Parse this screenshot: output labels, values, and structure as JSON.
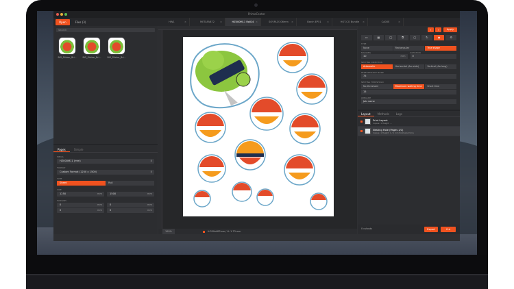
{
  "window": {
    "title": "PrimeCenter"
  },
  "toolbar": {
    "open_label": "Open",
    "files_label": "Files (3)"
  },
  "doc_tabs": [
    {
      "label": "HW1"
    },
    {
      "label": "METAFAB72"
    },
    {
      "label": "HZ000M11 Roll14",
      "active": true
    },
    {
      "label": "SOVRU2106mm"
    },
    {
      "label": "Barch EP51"
    },
    {
      "label": "HOT.CO Bundle"
    },
    {
      "label": "CA00E"
    }
  ],
  "left": {
    "search_placeholder": "Search",
    "thumbnails": [
      {
        "label": "BIG_Sticker_Bri..."
      },
      {
        "label": "BIG_Sticker_Bri..."
      },
      {
        "label": "BIG_Sticker_Bri..."
      }
    ],
    "subtabs": {
      "pages": "Pages",
      "simple": "Simple"
    },
    "media_label": "MEDIA",
    "media_value": "HZ000M11 (mm)",
    "format_label": "FORMAT",
    "format_value": "Custom Format (1250 x 1500)",
    "type_label": "TYPE",
    "type_sheet": "Sheet",
    "type_roll": "Roll",
    "size_label": "SIZE",
    "width_value": "1250",
    "height_value": "1500",
    "unit": "mm",
    "margins_label": "MARGINS",
    "margin_values": [
      "0",
      "0",
      "0",
      "0"
    ]
  },
  "canvas": {
    "zoom": "100%",
    "status": "H:350x487mm / H: 1.73 mm"
  },
  "right": {
    "apply_label": "Apply",
    "type_label": "TYPE",
    "type_opts": [
      "None",
      "Rectangular",
      "True shape"
    ],
    "margin_label": "MARGINS",
    "margin_value": "10",
    "margin_unit": "mm",
    "rotation_label": "ROTATION",
    "rotation_value": "0",
    "nesting_label": "NESTING DIRECTION",
    "nesting_opts": [
      "Automatic",
      "Horizontal (Aa wide)",
      "Vertical (Aa long)"
    ],
    "spacing_label": "PERFORMANCE MODE",
    "spacing_value": "75",
    "threshold_label": "NESTING THRESHOLD",
    "threshold_opts": [
      "No threshold",
      "Maximum waiting time",
      "Short time"
    ],
    "threshold_value": "15",
    "jobname_label": "JOBNAME",
    "jobname_value": "Job name",
    "list_tabs": {
      "layout": "Layout",
      "methods": "Methods",
      "logs": "Logs"
    },
    "list": [
      {
        "title": "Print Layout",
        "sub": "Copies: 1     Height: ..."
      },
      {
        "title": "Nesting Hole (Pages 1/1)",
        "sub": "Copies: 1     Height: 1 / 1 mm     Estimated time"
      }
    ],
    "bottom_info": "0 cutouts",
    "export_label": "Export",
    "cut_label": "Cut"
  }
}
